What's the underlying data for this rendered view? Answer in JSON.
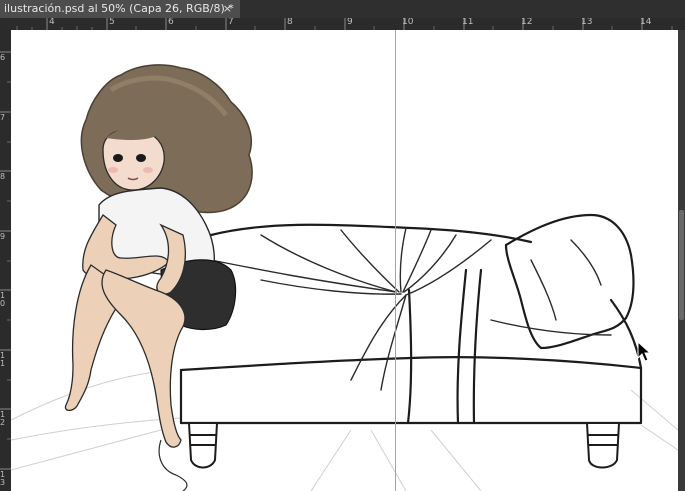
{
  "document_tab": {
    "title": "ilustración.psd al 50% (Capa 26, RGB/8) *",
    "close_glyph": "×"
  },
  "ruler_horizontal": [
    "4",
    "5",
    "6",
    "7",
    "8",
    "9",
    "10",
    "11",
    "12",
    "13",
    "14"
  ],
  "ruler_vertical": [
    "6",
    "7",
    "8",
    "9",
    "10",
    "11",
    "12",
    "13"
  ],
  "colors": {
    "workspace": "#535353",
    "ruler": "#2b2b2b",
    "guide": "#2cd3e0",
    "canvas": "#ffffff"
  },
  "icons": {
    "cursor": "arrow-cursor-icon",
    "close": "close-icon"
  }
}
